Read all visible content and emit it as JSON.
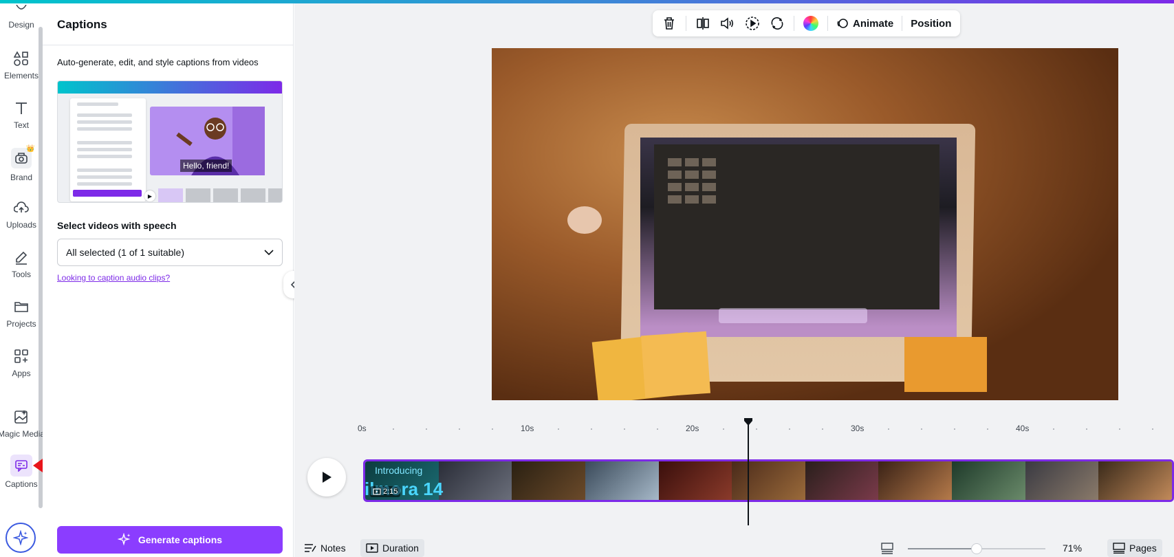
{
  "rail": {
    "items": [
      {
        "label": "Design",
        "icon": "design-icon"
      },
      {
        "label": "Elements",
        "icon": "elements-icon"
      },
      {
        "label": "Text",
        "icon": "text-icon"
      },
      {
        "label": "Brand",
        "icon": "brand-icon"
      },
      {
        "label": "Uploads",
        "icon": "uploads-icon"
      },
      {
        "label": "Tools",
        "icon": "tools-icon"
      },
      {
        "label": "Projects",
        "icon": "projects-icon"
      },
      {
        "label": "Apps",
        "icon": "apps-icon"
      },
      {
        "label": "Magic Media",
        "icon": "magic-media-icon"
      },
      {
        "label": "Captions",
        "icon": "captions-icon"
      }
    ],
    "brand_badge": "👑"
  },
  "panel": {
    "title": "Captions",
    "description": "Auto-generate, edit, and style captions from videos",
    "preview_caption": "Hello, friend!",
    "select_label": "Select videos with speech",
    "select_value": "All selected (1 of 1 suitable)",
    "link": "Looking to caption audio clips?",
    "generate_button": "Generate captions"
  },
  "toolbar": {
    "animate": "Animate",
    "position": "Position",
    "icons": [
      "trash-icon",
      "flip-icon",
      "volume-icon",
      "playback-icon",
      "loop-icon",
      "color-icon"
    ]
  },
  "timeline": {
    "ticks": [
      "0s",
      "10s",
      "20s",
      "30s",
      "40s"
    ],
    "clip_title_1": "Introducing",
    "clip_title_2": "ilmora 14",
    "clip_duration": "2:15"
  },
  "bottom": {
    "notes": "Notes",
    "duration": "Duration",
    "zoom": "71%",
    "pages": "Pages",
    "zoom_level": 0.5
  },
  "colors": {
    "accent": "#8b3dff",
    "track_border": "#7d2ae8",
    "link": "#7d2ae8"
  }
}
